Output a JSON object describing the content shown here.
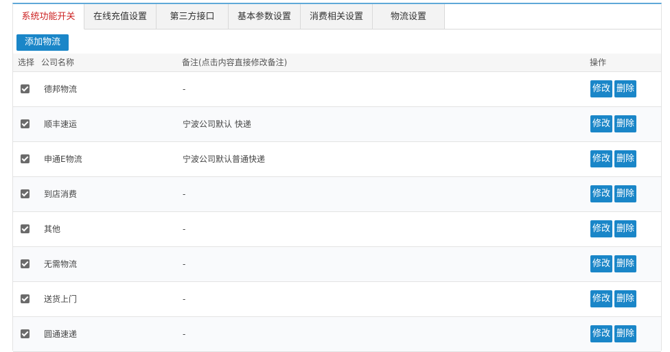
{
  "tabs": [
    "系统功能开关",
    "在线充值设置",
    "第三方接口",
    "基本参数设置",
    "消费相关设置",
    "物流设置"
  ],
  "add_button": "添加物流",
  "table": {
    "headers": {
      "select": "选择",
      "company": "公司名称",
      "note": "备注(点击内容直接修改备注)",
      "action": "操作"
    },
    "rows": [
      {
        "name": "德邦物流",
        "note": "-",
        "checked": true
      },
      {
        "name": "顺丰速运",
        "note": "宁波公司默认 快递",
        "checked": true
      },
      {
        "name": "申通E物流",
        "note": "宁波公司默认普通快递",
        "checked": true
      },
      {
        "name": "到店消费",
        "note": "-",
        "checked": true
      },
      {
        "name": "其他",
        "note": "-",
        "checked": true
      },
      {
        "name": "无需物流",
        "note": "-",
        "checked": true
      },
      {
        "name": "送货上门",
        "note": "-",
        "checked": true
      },
      {
        "name": "圆通速递",
        "note": "-",
        "checked": true
      }
    ],
    "edit_label": "修改",
    "delete_label": "删除"
  },
  "colors": {
    "accent": "#1a86c8",
    "active_tab_text": "#cc2222",
    "top_border": "#5ea8d8"
  },
  "icons": {
    "checkbox": "checkbox-checked-icon"
  }
}
